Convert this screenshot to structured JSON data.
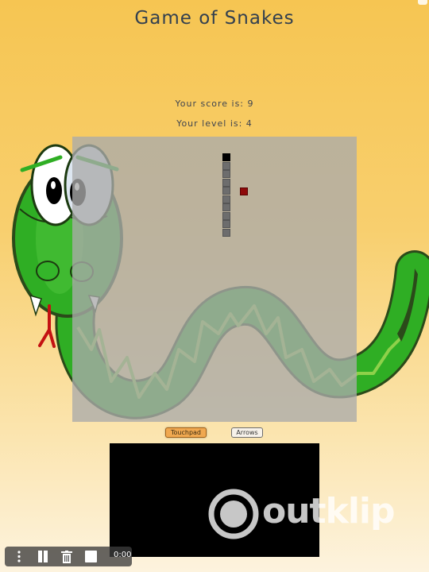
{
  "header": {
    "title": "Game of Snakes"
  },
  "stats": {
    "score_text": "Your score is: 9",
    "level_text": "Your level is: 4"
  },
  "controls": {
    "touchpad_label": "Touchpad",
    "arrows_label": "Arrows",
    "selected": "Touchpad"
  },
  "player": {
    "time": "0:00",
    "icons": [
      "more-vertical-icon",
      "pause-icon",
      "trash-icon",
      "stop-icon"
    ]
  },
  "watermark": {
    "text": "outklip"
  },
  "game": {
    "snake_length": 10,
    "heading": "up"
  },
  "colors": {
    "snake_head": "#000000",
    "snake_body": "#6d6d6d",
    "food": "#8e0a0a",
    "board": "#aaaaaa",
    "touchpad_active": "#f0a850"
  }
}
